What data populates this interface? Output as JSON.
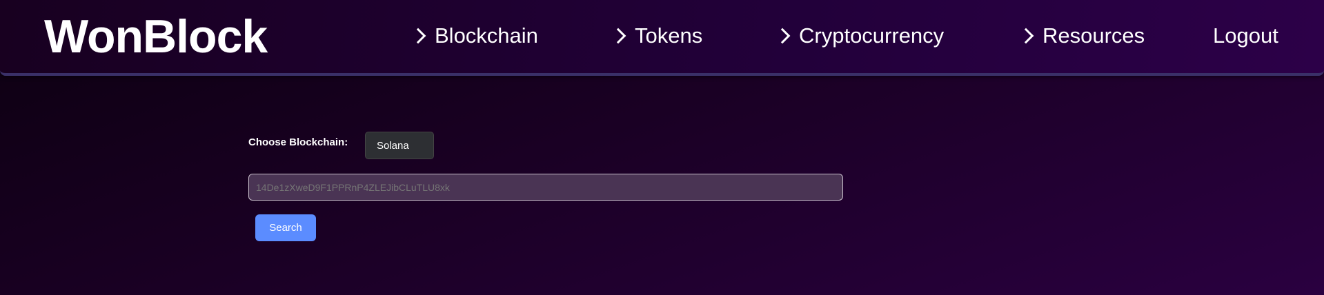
{
  "header": {
    "logo": "WonBlock",
    "nav": [
      {
        "label": "Blockchain",
        "icon": "chevron-right-icon"
      },
      {
        "label": "Tokens",
        "icon": "chevron-right-icon"
      },
      {
        "label": "Cryptocurrency",
        "icon": "chevron-right-icon"
      },
      {
        "label": "Resources",
        "icon": "chevron-right-icon"
      }
    ],
    "logout": "Logout"
  },
  "form": {
    "choose_label": "Choose Blockchain:",
    "selected_chain": "Solana",
    "address_placeholder": "14De1zXweD9F1PPRnP4ZLEJibCLuTLU8xk",
    "search_label": "Search"
  },
  "colors": {
    "accent": "#5b8cff",
    "input_bg": "#4a3454"
  }
}
